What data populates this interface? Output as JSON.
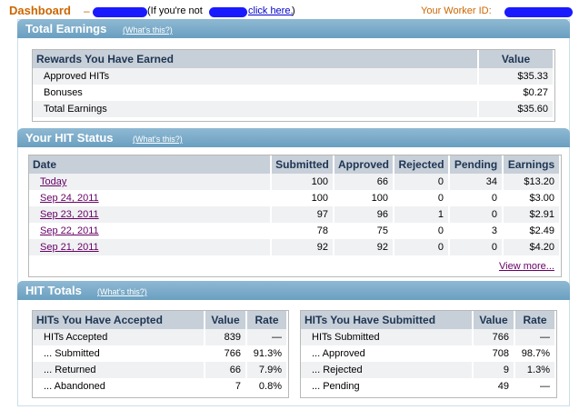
{
  "header": {
    "title": "Dashboard",
    "dash": "–",
    "not_you_prefix": "(If you're not",
    "click_here": "click here.",
    "close_paren": ")",
    "worker_id_label": "Your Worker ID:"
  },
  "total_earnings": {
    "title": "Total Earnings",
    "whats_this": "(What's this?)",
    "col_label": "Rewards You Have Earned",
    "col_value": "Value",
    "rows": [
      {
        "label": "Approved HITs",
        "value": "$35.33"
      },
      {
        "label": "Bonuses",
        "value": "$0.27"
      },
      {
        "label": "Total Earnings",
        "value": "$35.60"
      }
    ]
  },
  "hit_status": {
    "title": "Your HIT Status",
    "whats_this": "(What's this?)",
    "columns": [
      "Date",
      "Submitted",
      "Approved",
      "Rejected",
      "Pending",
      "Earnings"
    ],
    "rows": [
      {
        "date": "Today",
        "submitted": "100",
        "approved": "66",
        "rejected": "0",
        "pending": "34",
        "earnings": "$13.20"
      },
      {
        "date": "Sep 24, 2011",
        "submitted": "100",
        "approved": "100",
        "rejected": "0",
        "pending": "0",
        "earnings": "$3.00"
      },
      {
        "date": "Sep 23, 2011",
        "submitted": "97",
        "approved": "96",
        "rejected": "1",
        "pending": "0",
        "earnings": "$2.91"
      },
      {
        "date": "Sep 22, 2011",
        "submitted": "78",
        "approved": "75",
        "rejected": "0",
        "pending": "3",
        "earnings": "$2.49"
      },
      {
        "date": "Sep 21, 2011",
        "submitted": "92",
        "approved": "92",
        "rejected": "0",
        "pending": "0",
        "earnings": "$4.20"
      }
    ],
    "view_more": "View more..."
  },
  "hit_totals": {
    "title": "HIT Totals",
    "whats_this": "(What's this?)",
    "accepted": {
      "columns": [
        "HITs You Have Accepted",
        "Value",
        "Rate"
      ],
      "rows": [
        {
          "label": "HITs Accepted",
          "value": "839",
          "rate": "—"
        },
        {
          "label": "... Submitted",
          "value": "766",
          "rate": "91.3%"
        },
        {
          "label": "... Returned",
          "value": "66",
          "rate": "7.9%"
        },
        {
          "label": "... Abandoned",
          "value": "7",
          "rate": "0.8%"
        }
      ]
    },
    "submitted": {
      "columns": [
        "HITs You Have Submitted",
        "Value",
        "Rate"
      ],
      "rows": [
        {
          "label": "HITs Submitted",
          "value": "766",
          "rate": "—"
        },
        {
          "label": "... Approved",
          "value": "708",
          "rate": "98.7%"
        },
        {
          "label": "... Rejected",
          "value": "9",
          "rate": "1.3%"
        },
        {
          "label": "... Pending",
          "value": "49",
          "rate": "—"
        }
      ]
    }
  },
  "colors": {
    "accent_orange": "#cc6600",
    "section_header": "#7aabc9",
    "table_header": "#c7cfd8",
    "link_visited": "#660066"
  }
}
